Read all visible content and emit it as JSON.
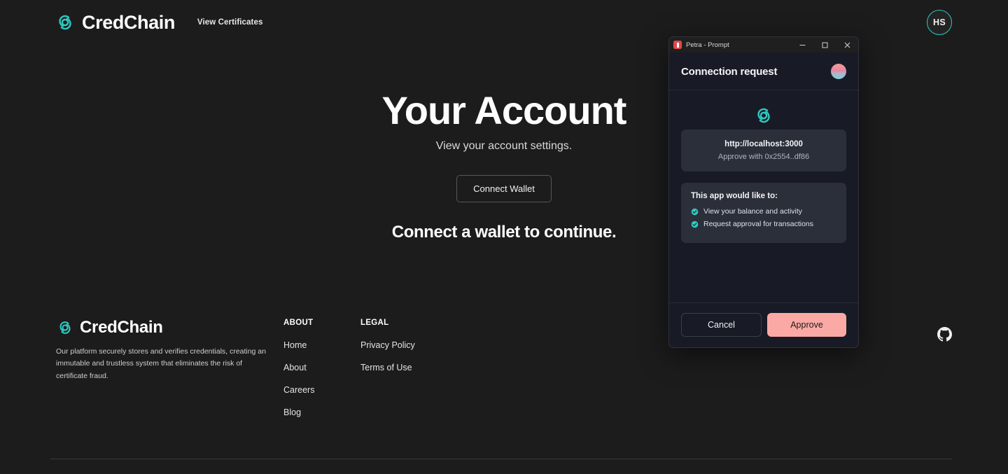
{
  "colors": {
    "page_bg": "#1c1c1c",
    "brand_teal": "#2ec9c0",
    "dialog_bg": "#181b26",
    "dialog_card_bg": "#2b2f3a",
    "approve_button": "#fba9a5",
    "titlebar_bg": "#1f1f1f",
    "petra_icon_red": "#e0484c"
  },
  "header": {
    "logo_icon": "credchain-logo-icon",
    "brand_name": "CredChain",
    "nav": [
      {
        "label": "View Certificates",
        "name": "view-certificates"
      }
    ],
    "avatar": {
      "initials": "HS",
      "name": "user-avatar"
    }
  },
  "hero": {
    "title": "Your Account",
    "subtitle": "View your account settings.",
    "connect_button": "Connect Wallet",
    "cta": "Connect a wallet to continue."
  },
  "footer": {
    "logo_icon": "credchain-logo-icon",
    "brand_name": "CredChain",
    "description": "Our platform securely stores and verifies credentials, creating an immutable and trustless system that eliminates the risk of certificate fraud.",
    "columns": [
      {
        "title": "ABOUT",
        "links": [
          "Home",
          "About",
          "Careers",
          "Blog"
        ]
      },
      {
        "title": "LEGAL",
        "links": [
          "Privacy Policy",
          "Terms of Use"
        ]
      }
    ],
    "social": {
      "icon": "github-icon",
      "label": "GitHub"
    }
  },
  "petra_dialog": {
    "titlebar": {
      "icon": "petra-app-icon",
      "title": "Petra - Prompt",
      "minimize_label": "Minimize",
      "maximize_label": "Maximize",
      "close_label": "Close"
    },
    "header": {
      "title": "Connection request",
      "account_avatar": "account-gradient-avatar"
    },
    "dapp": {
      "logo_icon": "credchain-logo-icon",
      "url": "http://localhost:3000",
      "approve_with": "Approve with 0x2554..df86"
    },
    "permissions": {
      "title": "This app would like to:",
      "items": [
        "View your balance and activity",
        "Request approval for transactions"
      ]
    },
    "actions": {
      "cancel": "Cancel",
      "approve": "Approve"
    }
  }
}
